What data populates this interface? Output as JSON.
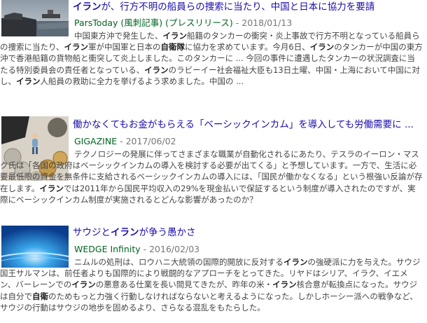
{
  "results": [
    {
      "title_before": "イラン",
      "title_after": "が、行方不明の船員らの捜索に当たり、中国と日本に協力を要請",
      "site": "ParsToday (風刺記事) (プレスリリース)",
      "date": "2018/01/13",
      "snippet": "中国東方沖で発生した、<b>イラン</b>船籍のタンカーの衝突・炎上事故で行方不明となっている船員らの捜索に当たり、<b>イラン</b>軍が中国軍と日本の<b>自衛隊</b>に協力を求めています。今月6日、<b>イラン</b>のタンカーが中国の東方沖で香港船籍の貨物船と衝突して炎上しました。このタンカーに ... 今回の事件に遭遇したタンカーの状況調査に当たる特別委員会の責任者となっている、<b>イラン</b>のラビーイー社会福祉大臣も13日土曜、中国・上海において中国に対し、<b>イラン</b>人船員の救助に全力を挙げるよう求めました。中国の ..."
    },
    {
      "title": "働かなくてもお金がもらえる「ベーシックインカム」を導入しても労働需要に ...",
      "site": "GIGAZINE",
      "date": "2017/06/02",
      "snippet": "テクノロジーの発展に伴ってさまざまな職業が自動化されるにあたり、テスラのイーロン・マスク氏は「各国の政府はベーシックインカムの導入を検討する必要が出てくる」と予想しています。一方で、生活に必要最低限の資金を無条件に支給されるベーシックインカムの導入には、「国民が働かなくなる」という根強い反論が存在します。<b>イラン</b>では2011年から国民平均収入の29%を現金払いで保証するという制度が導入されたのですが、実際にベーシックインカム制度が実施されるとどんな影響があったのか？"
    },
    {
      "title_before": "サウジと",
      "title_bold": "イラン",
      "title_after": "が争う愚かさ",
      "site": "WEDGE Infinity",
      "date": "2016/02/03",
      "snippet": "ニムルの処刑は、ロウハニ大統領の国際的開放に反対する<b>イラン</b>の強硬派に力を与えた。サウジ国王サルマンは、前任者よりも国際的により戦闘的なアプローチをとってきた。リヤドはシリア、イラク、イエメン、バーレーンでの<b>イラン</b>の悪意ある仕業を長い間見てきたが、昨年の米・<b>イラン</b>核合意が転換点になった。サウジは自分で<b>自衛</b>のためもっと力強く行動しなければならないと考えるようになった。しかしホーシー派への戦争など、サウジの行動はサウジの地歩を固めるより、さらなる混乱をもたらした。"
    }
  ],
  "icons": {
    "thumb1": "harbor-ship-image",
    "thumb2": "figurine-coins-image",
    "thumb3": "blue-light-image"
  }
}
